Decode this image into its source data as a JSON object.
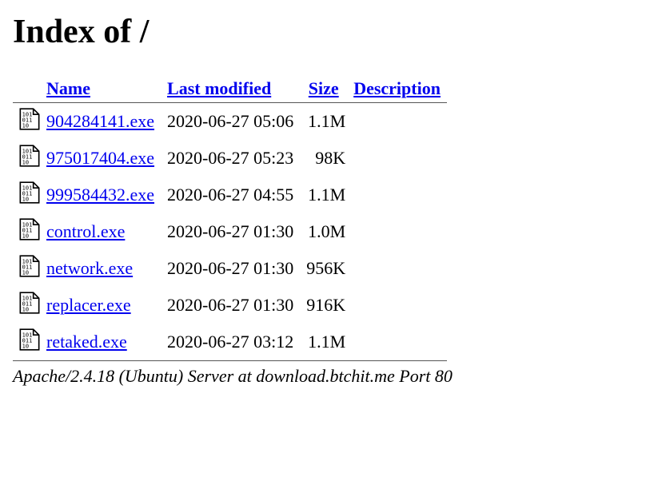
{
  "title": "Index of /",
  "columns": {
    "name": "Name",
    "modified": "Last modified",
    "size": "Size",
    "description": "Description"
  },
  "files": [
    {
      "name": "904284141.exe",
      "modified": "2020-06-27 05:06",
      "size": "1.1M",
      "description": ""
    },
    {
      "name": "975017404.exe",
      "modified": "2020-06-27 05:23",
      "size": "98K",
      "description": ""
    },
    {
      "name": "999584432.exe",
      "modified": "2020-06-27 04:55",
      "size": "1.1M",
      "description": ""
    },
    {
      "name": "control.exe",
      "modified": "2020-06-27 01:30",
      "size": "1.0M",
      "description": ""
    },
    {
      "name": "network.exe",
      "modified": "2020-06-27 01:30",
      "size": "956K",
      "description": ""
    },
    {
      "name": "replacer.exe",
      "modified": "2020-06-27 01:30",
      "size": "916K",
      "description": ""
    },
    {
      "name": "retaked.exe",
      "modified": "2020-06-27 03:12",
      "size": "1.1M",
      "description": ""
    }
  ],
  "footer": "Apache/2.4.18 (Ubuntu) Server at download.btchit.me Port 80"
}
